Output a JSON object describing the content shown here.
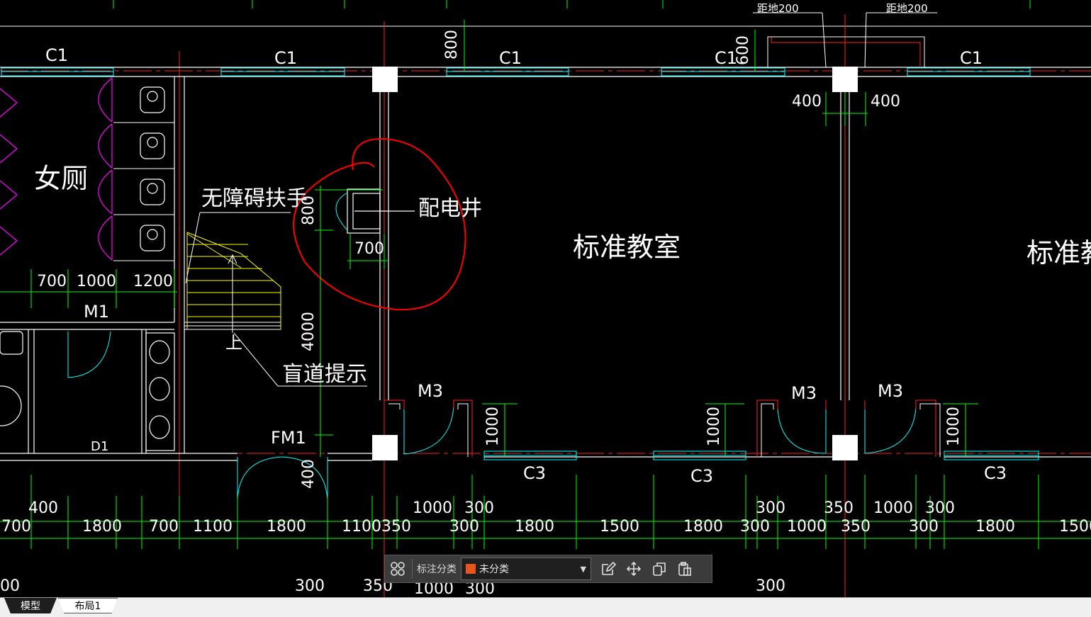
{
  "drawing": {
    "colors": {
      "background": "#000000",
      "wall": "#ffffff",
      "axis": "#ff2020",
      "dimension": "#00ff00",
      "window": "#00ffff",
      "fixture": "#ff00ff",
      "stair": "#ffff00",
      "markup": "#ff0000"
    },
    "rooms": {
      "womens_toilet": "女厕",
      "classroom_1": "标准教室",
      "classroom_2": "标准教"
    },
    "annotations": {
      "handrail": "无障碍扶手",
      "shaft": "配电井",
      "tactile": "盲道提示",
      "stair_up": "上"
    },
    "windows": {
      "c1_a": "C1",
      "c1_b": "C1",
      "c1_c": "C1",
      "c1_d": "C1",
      "c1_e": "C1",
      "c3_a": "C3",
      "c3_b": "C3",
      "c3_c": "C3"
    },
    "doors": {
      "m1": "M1",
      "m3_a": "M3",
      "m3_b": "M3",
      "m3_c": "M3",
      "fm1": "FM1",
      "d1": "D1"
    },
    "notes": {
      "sill_a": "距地200",
      "sill_b": "距地200"
    },
    "dims_top": {
      "d800": "800",
      "d600": "600",
      "d400a": "400",
      "d400b": "400"
    },
    "dims_left": {
      "d700": "700",
      "d1000": "1000",
      "d1200": "1200"
    },
    "dims_shaft": {
      "d800": "800",
      "d700": "700",
      "d4000": "4000",
      "d400": "400"
    },
    "dims_doors": {
      "a": "1000",
      "b": "1000",
      "c": "1000"
    },
    "dim_row1": {
      "a": "400",
      "b": "1000",
      "c": "300",
      "d": "300",
      "e": "350",
      "f": "1000",
      "g": "300"
    },
    "dim_row2": {
      "a": "700",
      "b": "1800",
      "c": "700",
      "d": "1100",
      "e": "1800",
      "f": "1100",
      "g": "350",
      "h": "300",
      "i": "1800",
      "j": "1500",
      "k": "1800",
      "l": "300",
      "m": "1000",
      "n": "350",
      "o": "300",
      "p": "1800",
      "q": "1500"
    },
    "dim_row3": {
      "a": "00",
      "b": "300",
      "c": "350",
      "d": "1000",
      "e": "300",
      "f": "300"
    }
  },
  "toolbar": {
    "label": "标注分类",
    "category_value": "未分类",
    "category_color": "#e8541c",
    "icons": [
      "grid-icon",
      "edit-icon",
      "move-icon",
      "copy-icon",
      "paste-icon"
    ]
  },
  "tabs": {
    "model": "模型",
    "layout1": "布局1"
  }
}
